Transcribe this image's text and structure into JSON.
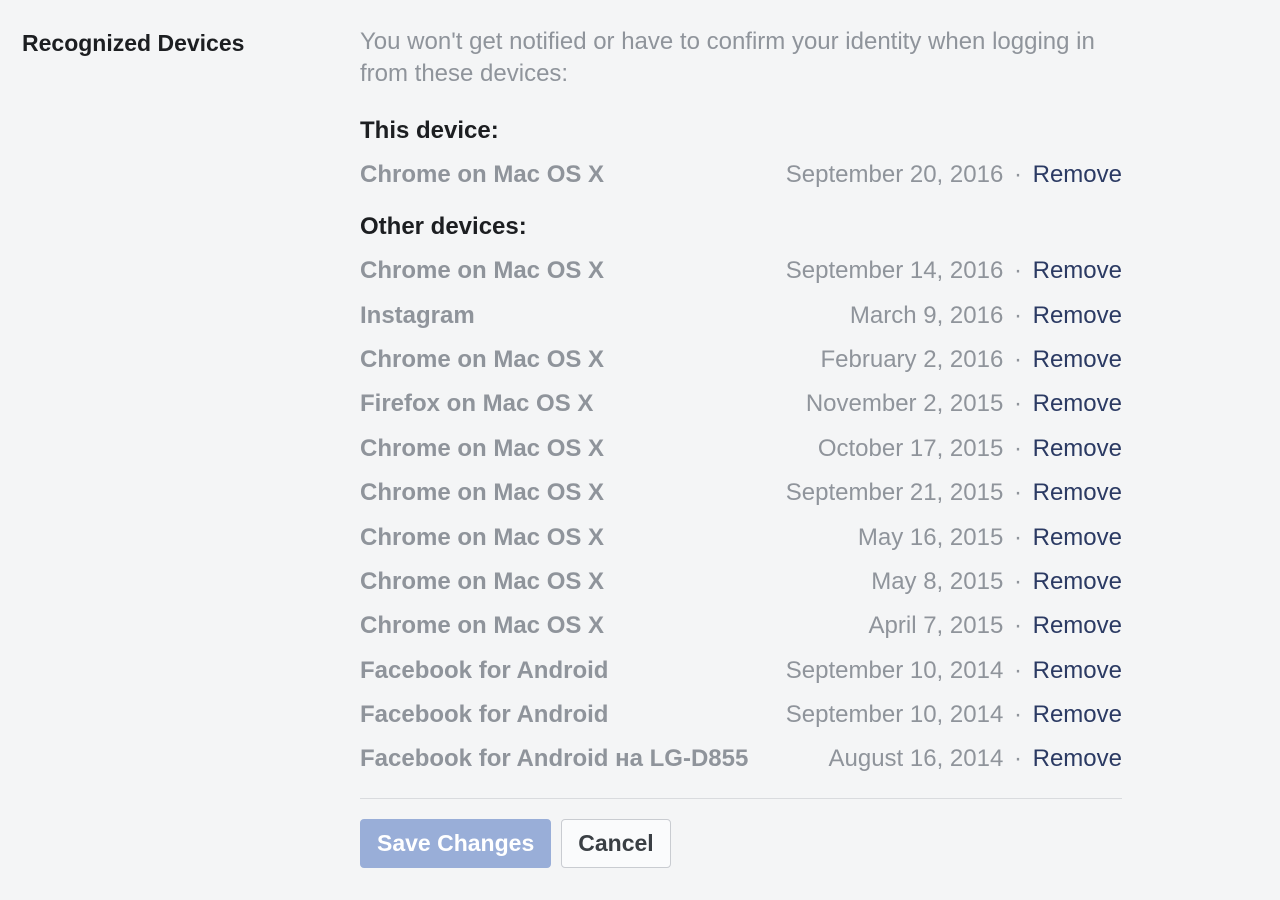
{
  "section": {
    "title": "Recognized Devices",
    "description": "You won't get notified or have to confirm your identity when logging in from these devices:"
  },
  "this_device_header": "This device:",
  "other_devices_header": "Other devices:",
  "remove_label": "Remove",
  "separator": " · ",
  "this_device": [
    {
      "name": "Chrome on Mac OS X",
      "date": "September 20, 2016"
    }
  ],
  "other_devices": [
    {
      "name": "Chrome on Mac OS X",
      "date": "September 14, 2016"
    },
    {
      "name": "Instagram",
      "date": "March 9, 2016"
    },
    {
      "name": "Chrome on Mac OS X",
      "date": "February 2, 2016"
    },
    {
      "name": "Firefox on Mac OS X",
      "date": "November 2, 2015"
    },
    {
      "name": "Chrome on Mac OS X",
      "date": "October 17, 2015"
    },
    {
      "name": "Chrome on Mac OS X",
      "date": "September 21, 2015"
    },
    {
      "name": "Chrome on Mac OS X",
      "date": "May 16, 2015"
    },
    {
      "name": "Chrome on Mac OS X",
      "date": "May 8, 2015"
    },
    {
      "name": "Chrome on Mac OS X",
      "date": "April 7, 2015"
    },
    {
      "name": "Facebook for Android",
      "date": "September 10, 2014"
    },
    {
      "name": "Facebook for Android",
      "date": "September 10, 2014"
    },
    {
      "name": "Facebook for Android на LG-D855",
      "date": "August 16, 2014"
    }
  ],
  "buttons": {
    "save": "Save Changes",
    "cancel": "Cancel"
  }
}
